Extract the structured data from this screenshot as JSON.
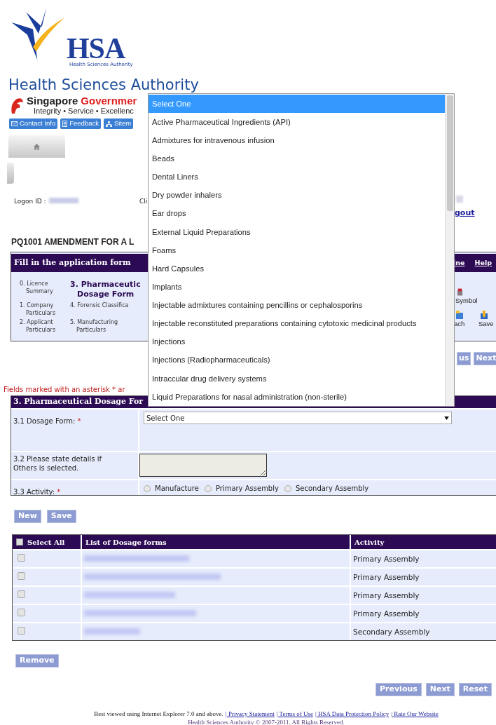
{
  "header": {
    "logo_text": "HSA",
    "logo_subtext": "Health Sciences Authority",
    "agency": "Health Sciences Authority",
    "gov_name": "Singapore",
    "gov_name_red": "Governmer",
    "gov_tagline": "Integrity • Service • Excellenc",
    "links": [
      {
        "kind": "mail",
        "label": "Contact Info"
      },
      {
        "kind": "doc",
        "label": "Feedback"
      },
      {
        "kind": "sitemap",
        "label": "Sitem"
      }
    ]
  },
  "user_bar": {
    "logon_label": "Logon ID :",
    "column_2_label": "Cli",
    "logout_link": "gout"
  },
  "page_title": "PQ1001 AMENDMENT FOR A L",
  "steps_panel": {
    "title": "Fill in the application form",
    "header_links": [
      "ine",
      "Help"
    ],
    "steps": [
      {
        "label": "0. Licence Summary",
        "selected": false
      },
      {
        "label": "1. Company Particulars",
        "selected": false
      },
      {
        "label": "2. Applicant Particulars",
        "selected": false
      },
      {
        "label": "3. Pharmaceutic Dosage Form",
        "selected": true
      },
      {
        "label": "4. Forensic Classifica",
        "selected": false
      },
      {
        "label": "5. Manufacturing Particulars",
        "selected": false
      }
    ],
    "tools": [
      {
        "kind": "box",
        "label": "Symbol"
      },
      {
        "kind": "folder",
        "label": "ach"
      },
      {
        "kind": "save",
        "label": "Save"
      }
    ]
  },
  "top_nav_buttons": [
    "us",
    "Next"
  ],
  "required_note": "Fields marked with an asterisk * ar",
  "section": {
    "title": "3. Pharmaceutical Dosage For",
    "fields": [
      {
        "kind": "select",
        "label": "3.1 Dosage Form:",
        "required_mark": "*",
        "value": "Select One"
      },
      {
        "kind": "textarea",
        "label": "3.2 Please state details if Others is selected."
      },
      {
        "kind": "radio",
        "label": "3.3 Activity:",
        "required_mark": "*",
        "options": [
          {
            "label": "Manufacture",
            "selected": false
          },
          {
            "label": "Primary Assembly",
            "selected": false
          },
          {
            "label": "Secondary Assembly",
            "selected": false
          }
        ]
      }
    ]
  },
  "form_buttons": [
    "New",
    "Save"
  ],
  "table": {
    "columns": [
      "Select All",
      "List of Dosage forms",
      "Activity"
    ],
    "select_all_checked": false,
    "rows": [
      {
        "checked": false,
        "activity": "Primary Assembly"
      },
      {
        "checked": false,
        "activity": "Primary Assembly"
      },
      {
        "checked": false,
        "activity": "Primary Assembly"
      },
      {
        "checked": false,
        "activity": "Primary Assembly"
      },
      {
        "checked": false,
        "activity": "Secondary Assembly"
      }
    ]
  },
  "remove_button": "Remove",
  "bottom_buttons": [
    "Previous",
    "Next",
    "Reset"
  ],
  "footer": {
    "note": "Best viewed using Internet Explorer 7.0 and above.",
    "links": [
      "| Privacy Statement",
      "| Terms of Use",
      "| HSA Data Protection Policy",
      "| Rate Our Website"
    ],
    "copyright": "Health Sciences Authority © 2007-2011. All Rights Reserved."
  },
  "dropdown": {
    "options": [
      {
        "label": "Select One",
        "selected": true
      },
      {
        "label": "Active Pharmaceutical Ingredients (API)",
        "selected": false
      },
      {
        "label": "Admixtures for intravenous infusion",
        "selected": false
      },
      {
        "label": "Beads",
        "selected": false
      },
      {
        "label": "Dental Liners",
        "selected": false
      },
      {
        "label": "Dry powder inhalers",
        "selected": false
      },
      {
        "label": "Ear drops",
        "selected": false
      },
      {
        "label": "External Liquid Preparations",
        "selected": false
      },
      {
        "label": "Foams",
        "selected": false
      },
      {
        "label": "Hard Capsules",
        "selected": false
      },
      {
        "label": "Implants",
        "selected": false
      },
      {
        "label": "Injectable admixtures containing pencillins or cephalosporins",
        "selected": false
      },
      {
        "label": "Injectable reconstituted preparations containing cytotoxic medicinal products",
        "selected": false
      },
      {
        "label": "Injections",
        "selected": false
      },
      {
        "label": "Injections (Radiopharmaceuticals)",
        "selected": false
      },
      {
        "label": "Intraccular drug delivery systems",
        "selected": false
      },
      {
        "label": "Liquid Preparations for nasal administration (non-sterile)",
        "selected": false
      }
    ]
  }
}
